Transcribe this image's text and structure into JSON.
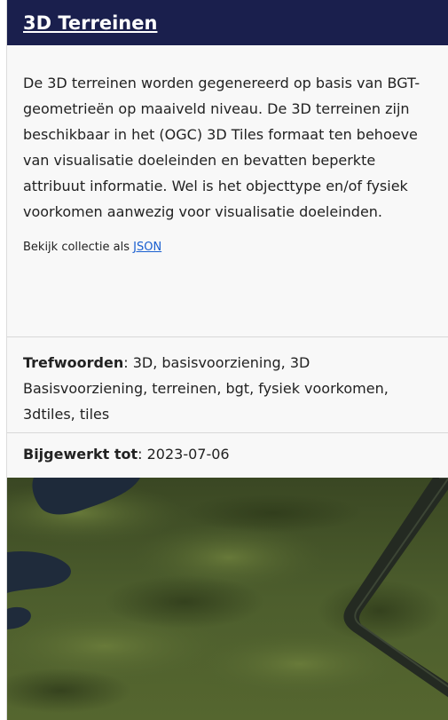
{
  "collection": {
    "title": "3D Terreinen",
    "description": "De 3D terreinen worden gegenereerd op basis van BGT-geometrieën op maaiveld niveau. De 3D terreinen zijn beschikbaar in het (OGC) 3D Tiles formaat ten behoeve van visualisatie doeleinden en bevatten beperkte attribuut informatie. Wel is het objecttype en/of fysiek voorkomen aanwezig voor visualisatie doeleinden.",
    "json_prefix": "Bekijk collectie als ",
    "json_link": "JSON"
  },
  "keywords": {
    "label": "Trefwoorden",
    "value": ": 3D, basisvoorziening, 3D Basisvoorziening, terreinen, bgt, fysiek voorkomen, 3dtiles, tiles"
  },
  "updated": {
    "label": "Bijgewerkt tot",
    "value": ": 2023-07-06"
  },
  "colors": {
    "header_bg": "#1a1f4d",
    "terrain": "#4a5a2c",
    "water": "#1e2a3a",
    "link": "#1a5fd0"
  }
}
